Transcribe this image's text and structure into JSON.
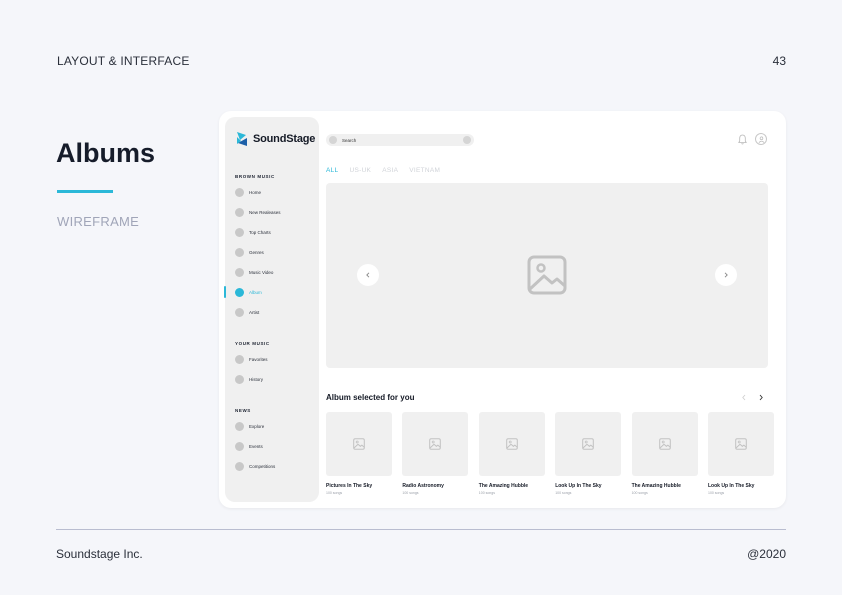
{
  "page": {
    "section": "LAYOUT & INTERFACE",
    "page_number": "43",
    "title": "Albums",
    "subtitle": "WIREFRAME",
    "footer_left": "Soundstage Inc.",
    "footer_right": "@2020"
  },
  "colors": {
    "accent": "#2bb8d8",
    "placeholder": "#f0f0f0",
    "dot": "#c8c8c8"
  },
  "app": {
    "brand": "SoundStage",
    "sidebar": {
      "sections": [
        {
          "label": "BROWN MUSIC",
          "items": [
            "Home",
            "New Realeases",
            "Top Charts",
            "Genres",
            "Music Video",
            "Album",
            "Artist"
          ]
        },
        {
          "label": "YOUR MUSIC",
          "items": [
            "Favorites",
            "History"
          ]
        },
        {
          "label": "NEWS",
          "items": [
            "Explore",
            "Events",
            "Competitions"
          ]
        }
      ],
      "active_item": "Album"
    },
    "search": {
      "placeholder": "Search"
    },
    "tabs": [
      "ALL",
      "US-UK",
      "ASIA",
      "VIETNAM"
    ],
    "active_tab": "ALL",
    "album_section": {
      "title": "Album selected for you",
      "cards": [
        {
          "title": "Pictures In The Sky",
          "sub": "100 songs"
        },
        {
          "title": "Radio Astronomy",
          "sub": "100 songs"
        },
        {
          "title": "The Amazing Hubble",
          "sub": "100 songs"
        },
        {
          "title": "Look Up In The Sky",
          "sub": "100 songs"
        },
        {
          "title": "The Amazing Hubble",
          "sub": "100 songs"
        },
        {
          "title": "Look Up In The Sky",
          "sub": "100 songs"
        }
      ]
    }
  }
}
